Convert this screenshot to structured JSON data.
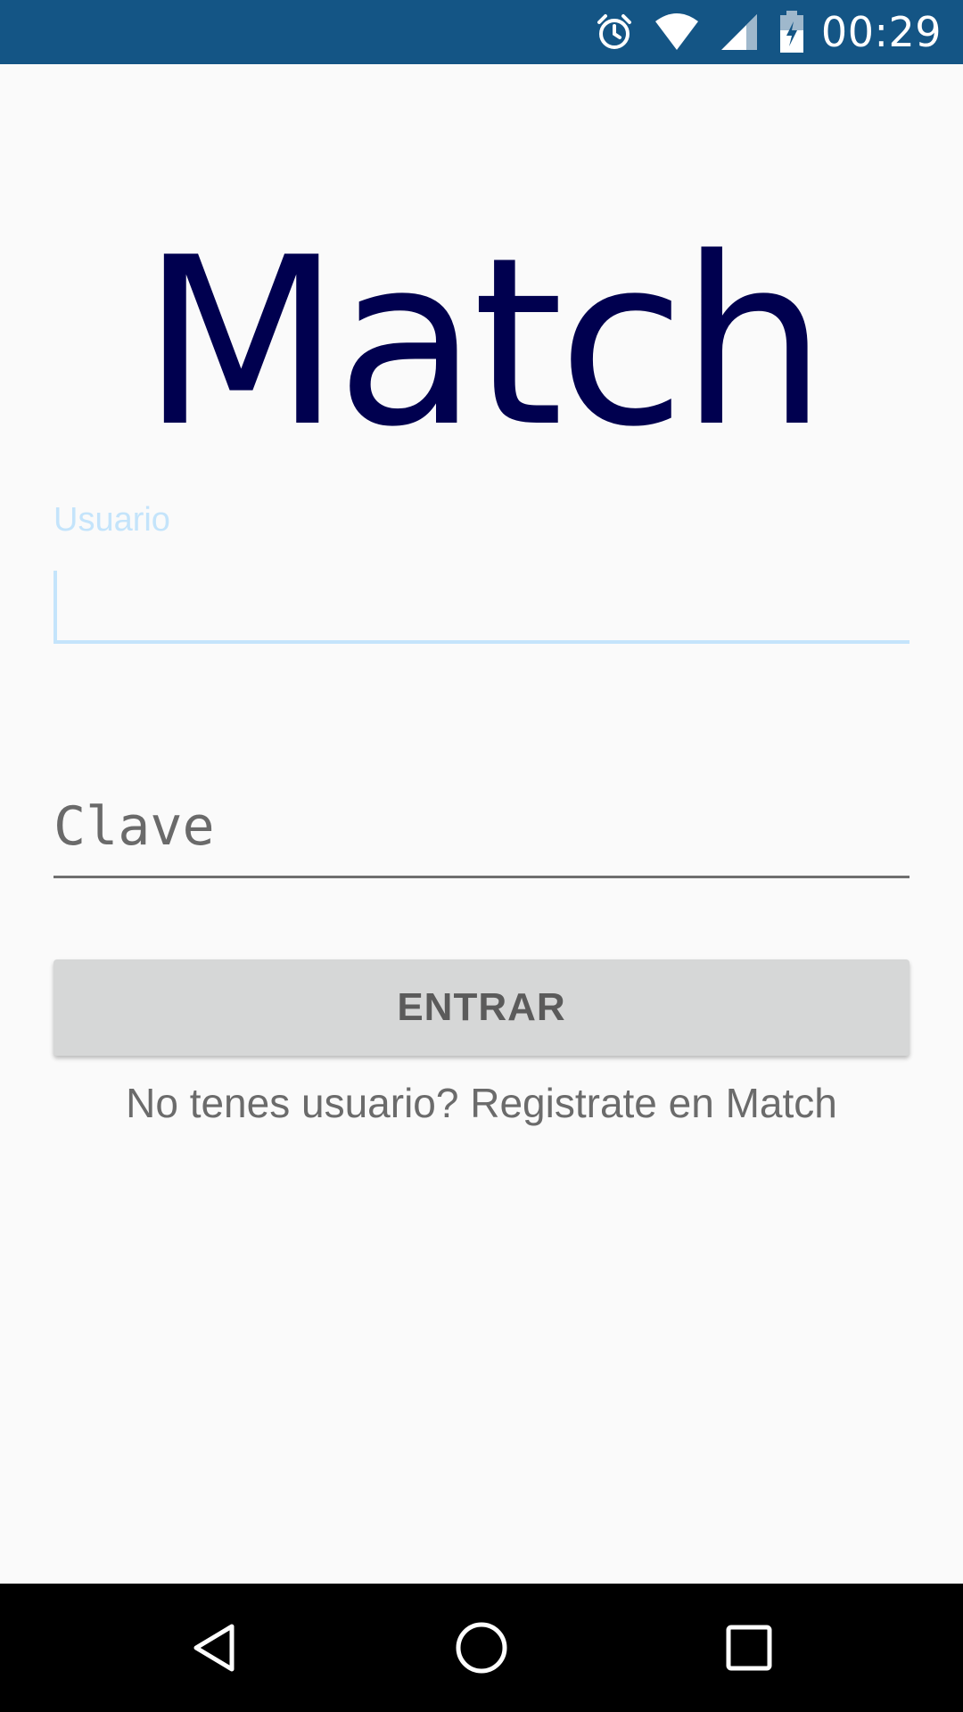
{
  "status_bar": {
    "time": "00:29",
    "icons": [
      "alarm-icon",
      "wifi-icon",
      "cell-signal-icon",
      "battery-charging-icon"
    ],
    "background": "#145585"
  },
  "app": {
    "logo_text": "Match",
    "logo_color": "#00004f"
  },
  "form": {
    "username": {
      "label": "Usuario",
      "value": "",
      "focused": true,
      "accent": "#c4e4fb"
    },
    "password": {
      "placeholder": "Clave",
      "value": ""
    },
    "submit_label": "ENTRAR",
    "register_text": "No tenes usuario? Registrate en Match"
  },
  "nav_bar": {
    "buttons": [
      "back-icon",
      "home-icon",
      "recents-icon"
    ]
  }
}
